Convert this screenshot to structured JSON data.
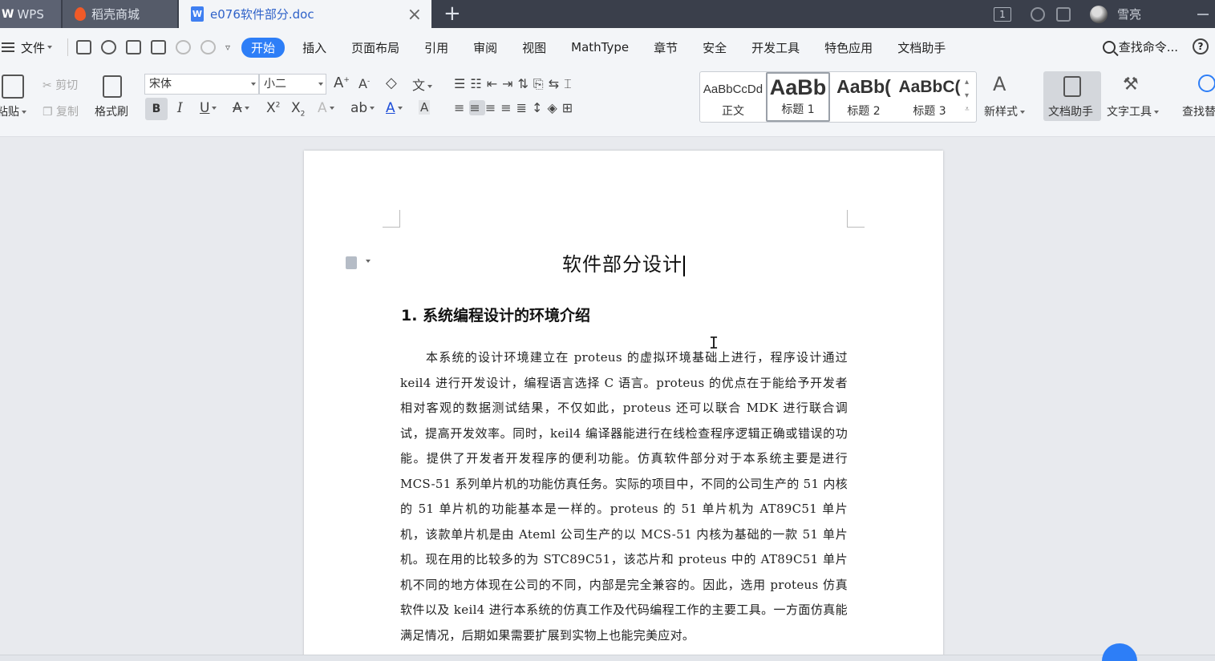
{
  "tabs": {
    "wps": "WPS",
    "wps_logo": "W",
    "store": "稻壳商城",
    "doc": "e076软件部分.doc",
    "doc_icon": "W",
    "close": "×",
    "add": "+"
  },
  "titlebar": {
    "window_count": "1",
    "username": "雪亮"
  },
  "menubar": {
    "file": "文件",
    "items": [
      "开始",
      "插入",
      "页面布局",
      "引用",
      "审阅",
      "视图",
      "MathType",
      "章节",
      "安全",
      "开发工具",
      "特色应用",
      "文档助手"
    ],
    "search_placeholder": "查找命令...",
    "help": "?"
  },
  "ribbon": {
    "paste": "粘贴",
    "cut": "剪切",
    "copy": "复制",
    "format_painter": "格式刷",
    "font_name": "宋体",
    "font_size": "小二",
    "styles": [
      {
        "sample": "AaBbCcDd",
        "name": "正文"
      },
      {
        "sample": "AaBb",
        "name": "标题 1"
      },
      {
        "sample": "AaBb(",
        "name": "标题 2"
      },
      {
        "sample": "AaBbC(",
        "name": "标题 3"
      }
    ],
    "new_style": "新样式",
    "doc_helper": "文档助手",
    "text_tools": "文字工具",
    "find_replace": "查找替"
  },
  "document": {
    "title": "软件部分设计",
    "heading1": "1. 系统编程设计的环境介绍",
    "paragraph": "本系统的设计环境建立在 proteus 的虚拟环境基础上进行，程序设计通过 keil4 进行开发设计，编程语言选择 C 语言。proteus 的优点在于能给予开发者相对客观的数据测试结果，不仅如此，proteus 还可以联合 MDK 进行联合调试，提高开发效率。同时，keil4 编译器能进行在线检查程序逻辑正确或错误的功能。提供了开发者开发程序的便利功能。仿真软件部分对于本系统主要是进行 MCS-51 系列单片机的功能仿真任务。实际的项目中，不同的公司生产的 51 内核的 51 单片机的功能基本是一样的。proteus 的 51 单片机为 AT89C51 单片机，该款单片机是由 Ateml 公司生产的以 MCS-51 内核为基础的一款 51 单片机。现在用的比较多的为 STC89C51，该芯片和 proteus 中的 AT89C51 单片机不同的地方体现在公司的不同，内部是完全兼容的。因此，选用 proteus 仿真软件以及 keil4 进行本系统的仿真工作及代码编程工作的主要工具。一方面仿真能满足情况，后期如果需要扩展到实物上也能完美应对。"
  },
  "colors": {
    "accent": "#2d7ef7",
    "tabbar_bg": "#3a3f4b",
    "toolbar_bg": "#f3f5f8",
    "doc_tab_text": "#2f62c9"
  }
}
